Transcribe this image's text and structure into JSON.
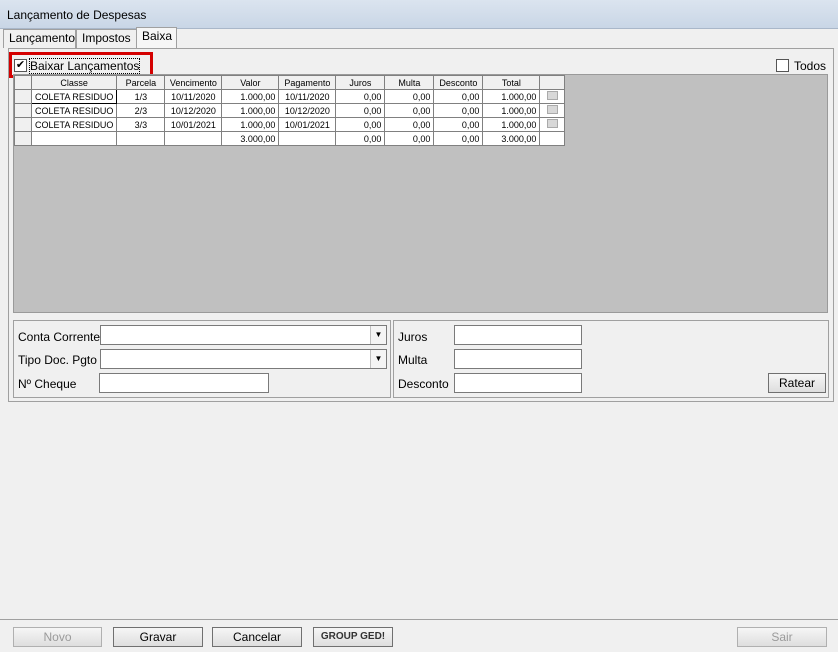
{
  "window": {
    "title": "Lançamento de Despesas"
  },
  "tabs": [
    {
      "label": "Lançamento"
    },
    {
      "label": "Impostos"
    },
    {
      "label": "Baixa"
    }
  ],
  "baixa": {
    "baixar_label": "Baixar Lançamentos",
    "baixar_checked": true,
    "todos_label": "Todos",
    "todos_checked": false
  },
  "grid": {
    "columns": [
      "Classe",
      "Parcela",
      "Vencimento",
      "Valor",
      "Pagamento",
      "Juros",
      "Multa",
      "Desconto",
      "Total"
    ],
    "rows": [
      [
        "COLETA RESIDUO",
        "1/3",
        "10/11/2020",
        "1.000,00",
        "10/11/2020",
        "0,00",
        "0,00",
        "0,00",
        "1.000,00"
      ],
      [
        "COLETA RESIDUO",
        "2/3",
        "10/12/2020",
        "1.000,00",
        "10/12/2020",
        "0,00",
        "0,00",
        "0,00",
        "1.000,00"
      ],
      [
        "COLETA RESIDUO",
        "3/3",
        "10/01/2021",
        "1.000,00",
        "10/01/2021",
        "0,00",
        "0,00",
        "0,00",
        "1.000,00"
      ]
    ],
    "totals": [
      "",
      "",
      "",
      "3.000,00",
      "",
      "0,00",
      "0,00",
      "0,00",
      "3.000,00"
    ]
  },
  "form": {
    "conta_corrente_label": "Conta Corrente",
    "conta_corrente_value": "",
    "tipo_doc_label": "Tipo Doc. Pgto",
    "tipo_doc_value": "",
    "cheque_label": "Nº Cheque",
    "cheque_value": "",
    "juros_label": "Juros",
    "juros_value": "",
    "multa_label": "Multa",
    "multa_value": "",
    "desconto_label": "Desconto",
    "desconto_value": "",
    "ratear_label": "Ratear"
  },
  "footer": {
    "novo": "Novo",
    "gravar": "Gravar",
    "cancelar": "Cancelar",
    "group_ged": "GROUP GED!",
    "sair": "Sair"
  }
}
